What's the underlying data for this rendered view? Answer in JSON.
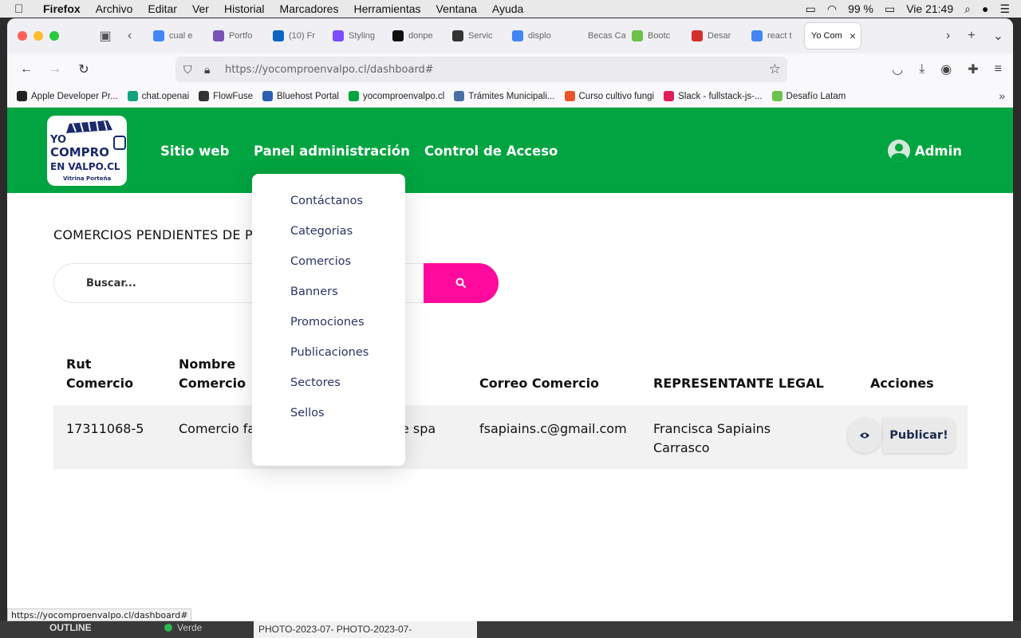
{
  "os_menubar": {
    "app_name": "Firefox",
    "menus": [
      "Archivo",
      "Editar",
      "Ver",
      "Historial",
      "Marcadores",
      "Herramientas",
      "Ventana",
      "Ayuda"
    ],
    "battery": "99 %",
    "clock": "Vie 21:49"
  },
  "browser": {
    "tabs": [
      {
        "label": "cual e",
        "icon": "google-icon",
        "color": "#4285f4"
      },
      {
        "label": "Portfo",
        "icon": "bootstrap-icon",
        "color": "#7952b3"
      },
      {
        "label": "(10) Fr",
        "icon": "linkedin-icon",
        "color": "#0a66c2"
      },
      {
        "label": "Styling",
        "icon": "styling-icon",
        "color": "#7c4dff"
      },
      {
        "label": "donpe",
        "icon": "github-icon",
        "color": "#111111"
      },
      {
        "label": "Servic",
        "icon": "info-icon",
        "color": "#333333"
      },
      {
        "label": "displo",
        "icon": "google-icon",
        "color": "#4285f4"
      },
      {
        "label": "Becas Cap",
        "icon": "blank-icon",
        "color": "#f0f0f4"
      },
      {
        "label": "Bootc",
        "icon": "code-icon",
        "color": "#6cc24a"
      },
      {
        "label": "Desar",
        "icon": "desafio-icon",
        "color": "#d32f2f"
      },
      {
        "label": "react t",
        "icon": "google-icon",
        "color": "#4285f4"
      }
    ],
    "active_tab": {
      "label": "Yo Com"
    },
    "url_host": "https://yocomproenvalpo.cl",
    "url_path": "/dashboard#",
    "bookmarks": [
      {
        "label": "Apple Developer Pr...",
        "color": "#222222"
      },
      {
        "label": "chat.openai",
        "color": "#10a37f"
      },
      {
        "label": "FlowFuse",
        "color": "#333333"
      },
      {
        "label": "Bluehost Portal",
        "color": "#2f5fb3"
      },
      {
        "label": "yocomproenvalpo.cl",
        "color": "#00a440"
      },
      {
        "label": "Trámites Municipali...",
        "color": "#4a6fa5"
      },
      {
        "label": "Curso cultivo fungi",
        "color": "#e8552a"
      },
      {
        "label": "Slack - fullstack-js-...",
        "color": "#e01e5a"
      },
      {
        "label": "Desafío Latam",
        "color": "#6cc24a"
      }
    ],
    "status_url": "https://yocomproenvalpo.cl/dashboard#"
  },
  "site": {
    "brand_color": "#00a440",
    "accent_color": "#ff0a9c",
    "logo": {
      "line1": "YO",
      "line2": "COMPRO",
      "line3": "EN VALPO.CL",
      "tagline": "Vitrina Porteña"
    },
    "nav": {
      "sitio_web": "Sitio web",
      "panel": "Panel administración",
      "control": "Control de Acceso",
      "admin": "Admin"
    },
    "dropdown": [
      "Contáctanos",
      "Categorias",
      "Comercios",
      "Banners",
      "Promociones",
      "Publicaciones",
      "Sectores",
      "Sellos"
    ],
    "page_title": "COMERCIOS PENDIENTES DE P",
    "search": {
      "placeholder": "Buscar..."
    },
    "table": {
      "headers": {
        "rut": "Rut Comercio",
        "nombre": "Nombre Comercio",
        "correo": "Correo Comercio",
        "representante": "REPRESENTANTE LEGAL",
        "acciones": "Acciones"
      },
      "rows": [
        {
          "rut": "17311068-5",
          "nombre": "Comercio fa",
          "razon": "e spa",
          "correo": "fsapiains.c@gmail.com",
          "representante": "Francisca Sapiains Carrasco",
          "publicar": "Publicar!"
        }
      ]
    }
  },
  "desktop": {
    "outline": "OUTLINE",
    "verde": "Verde",
    "files": "PHOTO-2023-07-  PHOTO-2023-07-"
  }
}
